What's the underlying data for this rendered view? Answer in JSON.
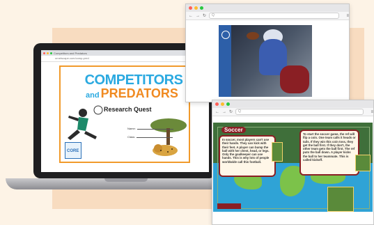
{
  "laptop": {
    "tab_label": "Competitors and Predators",
    "url": "ornetscape.com/comp-pred",
    "cover": {
      "title_line1": "COMPETITORS",
      "title_line2_and": "and",
      "title_line2_word": "PREDATORS",
      "subtitle": "Research Quest",
      "name_label": "Name:",
      "class_label": "Class:",
      "logo_text": "CORE"
    }
  },
  "window_football": {
    "url_placeholder": "Q"
  },
  "window_soccer": {
    "url_placeholder": "Q",
    "section_heading": "Soccer",
    "left_text": "In soccer, most players can't use their hands. They can kick with their feet. A player can bump the ball with her chest, head, or legs. Only the goalkeeper can use hands. This is why lots of people worldwide call this football.",
    "right_text": "To start the soccer game, the ref will flip a coin. One team calls it heads or tails. If they win this coin toss, they get the ball first. If they don't, the other team gets the ball first. The ref puts the ball down. A player kicks the ball to her teammate. This is called kickoff."
  },
  "colors": {
    "accent_blue": "#2aa9e0",
    "accent_orange": "#f08a21",
    "soccer_red": "#8a1f24"
  }
}
